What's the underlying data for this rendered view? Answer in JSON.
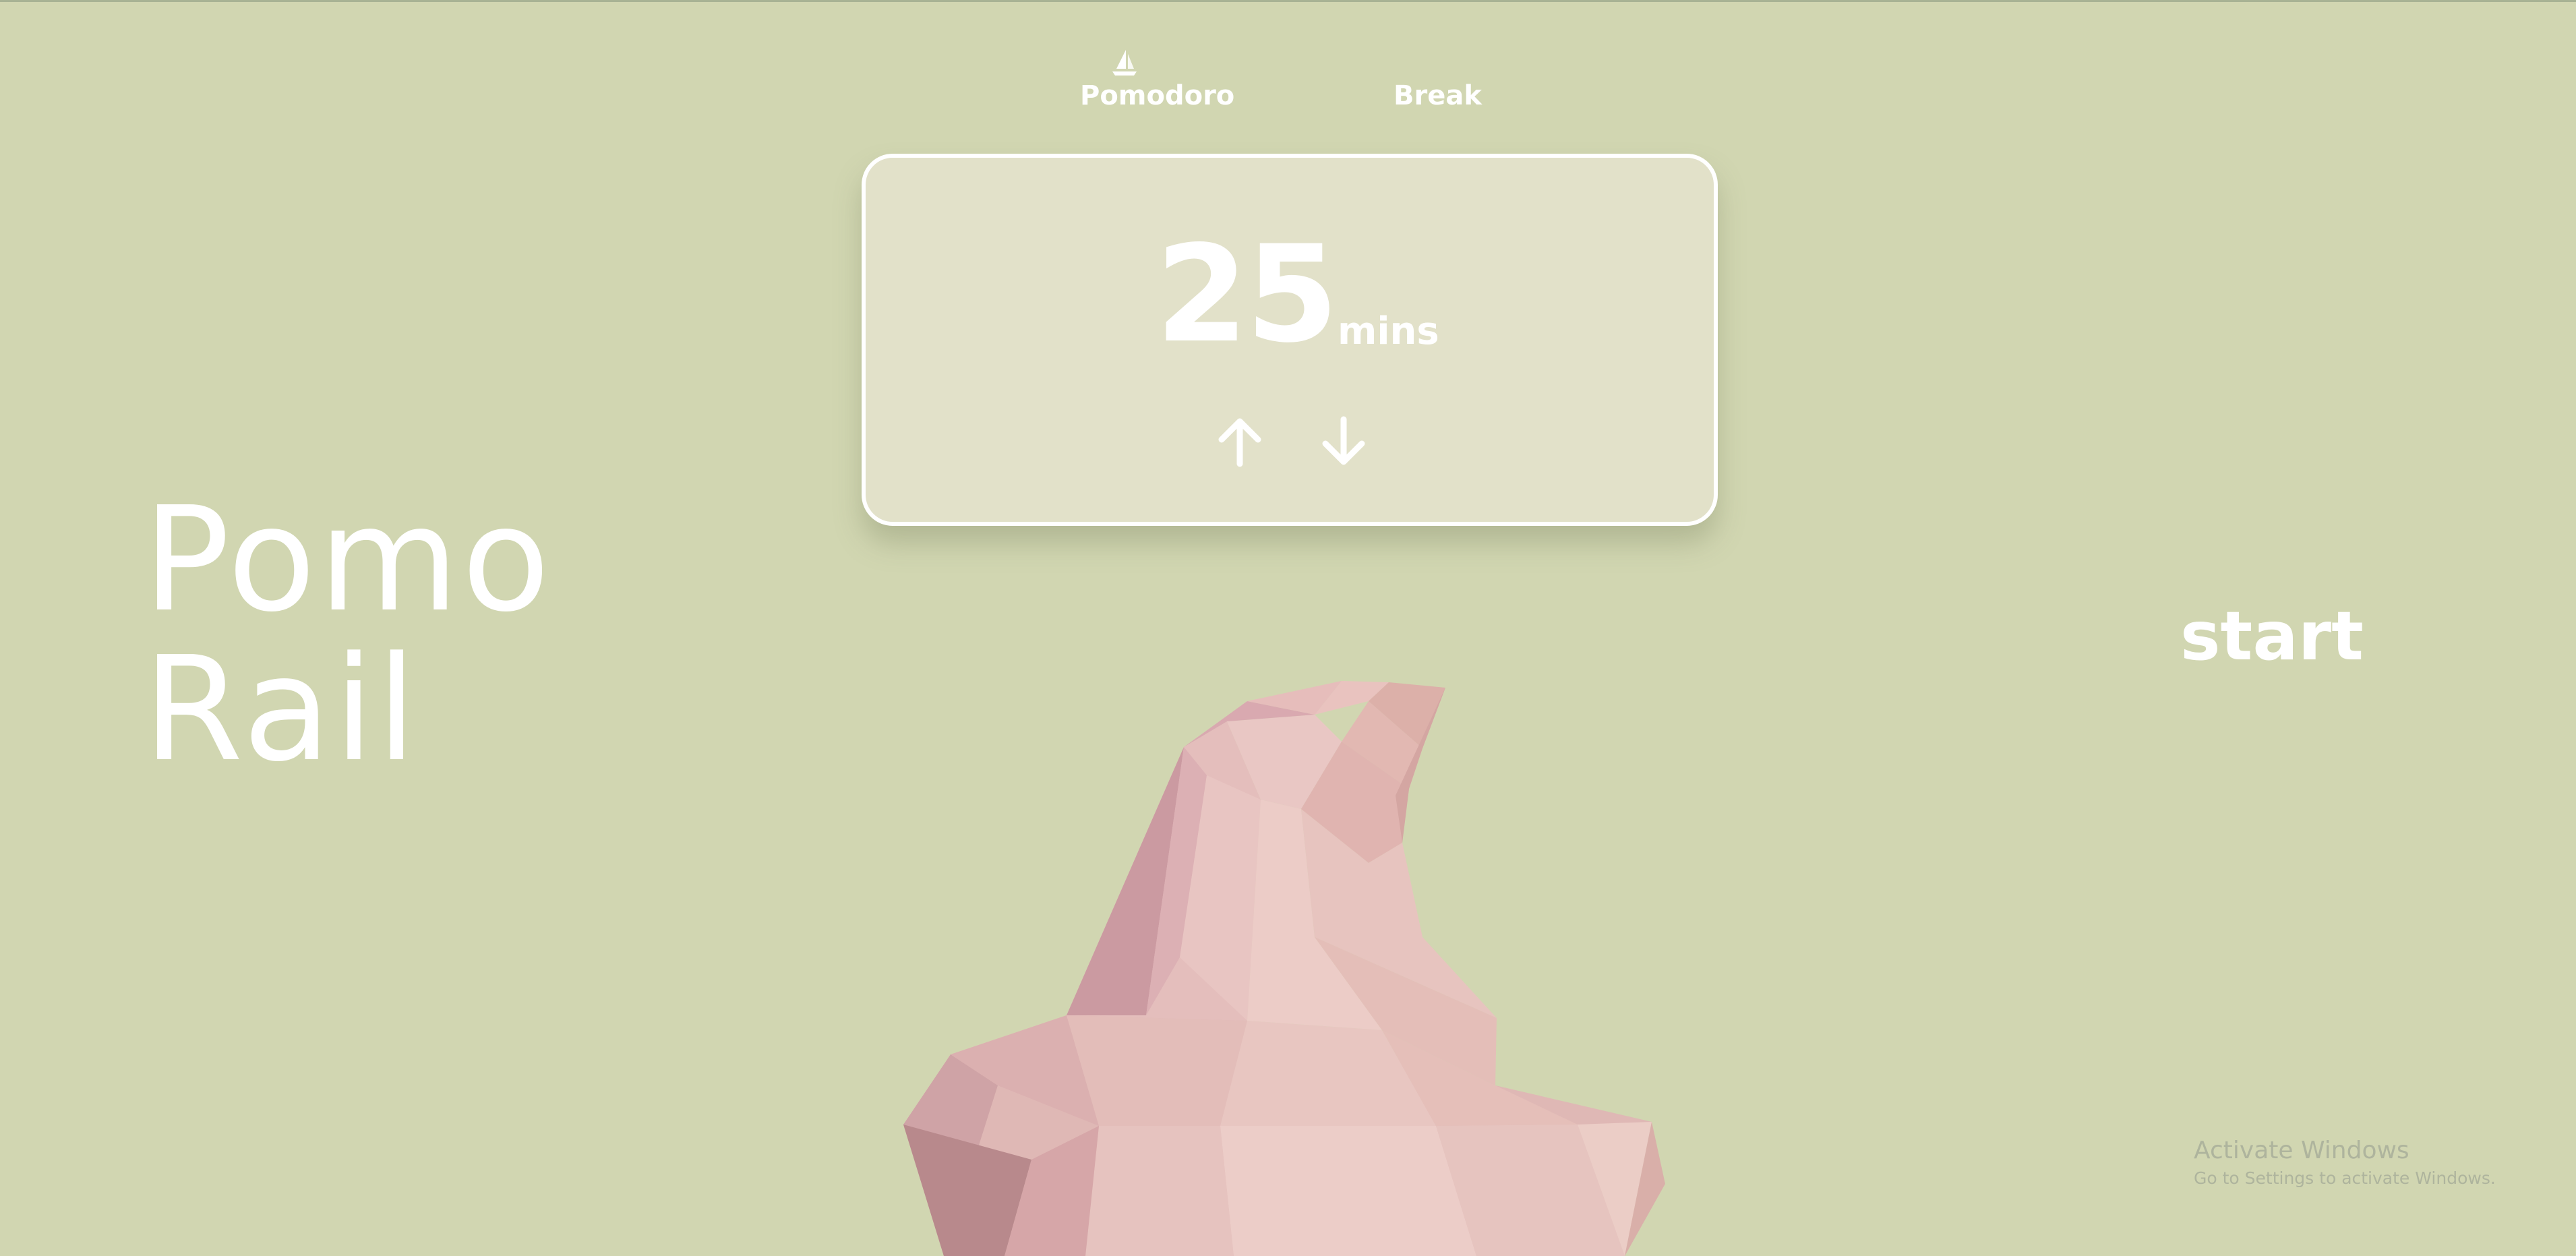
{
  "app": {
    "brand_line1": "Pomo",
    "brand_line2": "Rail"
  },
  "tabs": {
    "pomodoro_label": "Pomodoro",
    "break_label": "Break",
    "active_tab": "Pomodoro",
    "active_icon": "sail-boat-icon"
  },
  "timer": {
    "minutes": "25",
    "unit": "mins",
    "increase_icon": "arrow-up-icon",
    "decrease_icon": "arrow-down-icon"
  },
  "controls": {
    "start_label": "start"
  },
  "watermark": {
    "title": "Activate Windows",
    "subtitle": "Go to Settings to activate Windows."
  },
  "colors": {
    "background": "#d1d6b1",
    "card": "#e2e1c9",
    "text": "#ffffff",
    "illustration": "#e4c2bd"
  }
}
